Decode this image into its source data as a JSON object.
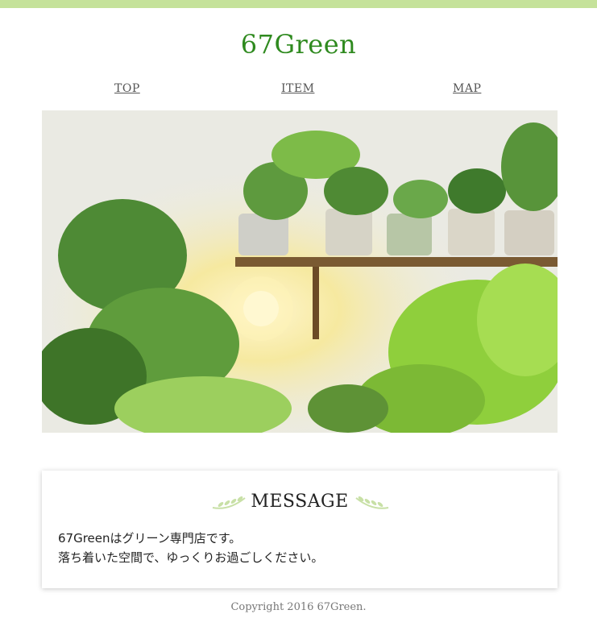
{
  "site": {
    "logo": "67Green"
  },
  "nav": {
    "items": [
      {
        "label": "TOP"
      },
      {
        "label": "ITEM"
      },
      {
        "label": "MAP"
      }
    ]
  },
  "hero": {
    "alt": "Potted plants on a wooden shelf with a warm lamp and ferns"
  },
  "message": {
    "title": "MESSAGE",
    "lines": [
      "67Greenはグリーン専門店です。",
      "落ち着いた空間で、ゆっくりお過ごしください。"
    ]
  },
  "footer": {
    "copyright": "Copyright 2016 67Green."
  },
  "colors": {
    "accent_bar": "#c5e29a",
    "logo": "#2f8a1f",
    "sprig": "#c8e0a6"
  }
}
